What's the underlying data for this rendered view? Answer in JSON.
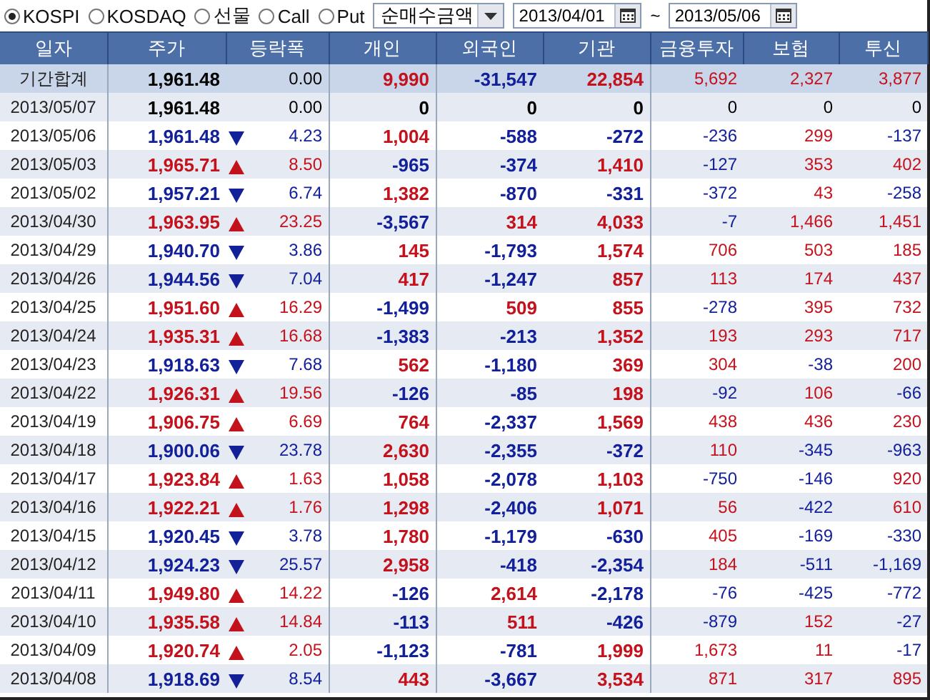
{
  "markets": [
    {
      "label": "KOSPI",
      "selected": true
    },
    {
      "label": "KOSDAQ",
      "selected": false
    },
    {
      "label": "선물",
      "selected": false
    },
    {
      "label": "Call",
      "selected": false
    },
    {
      "label": "Put",
      "selected": false
    }
  ],
  "measure": {
    "value": "순매수금액"
  },
  "date_range": {
    "start": "2013/04/01",
    "separator": "~",
    "end": "2013/05/06"
  },
  "columns": [
    "일자",
    "주가",
    "등락폭",
    "개인",
    "외국인",
    "기관",
    "금융투자",
    "보험",
    "투신"
  ],
  "rows": [
    {
      "kind": "total",
      "date": "기간합계",
      "price": "1,961.48",
      "rising": false,
      "falling": false,
      "change": "0.00",
      "flows": [
        {
          "value": "9,990",
          "color": "#c4121c"
        },
        {
          "value": "-31,547",
          "color": "#12209a"
        },
        {
          "value": "22,854",
          "color": "#c4121c"
        },
        {
          "value": "5,692",
          "color": "#c4121c"
        },
        {
          "value": "2,327",
          "color": "#c4121c"
        },
        {
          "value": "3,877",
          "color": "#c4121c"
        }
      ]
    },
    {
      "kind": "day",
      "date": "2013/05/07",
      "price": "1,961.48",
      "rising": false,
      "falling": false,
      "change": "0.00",
      "flows": [
        {
          "value": "0",
          "color": "#000000"
        },
        {
          "value": "0",
          "color": "#000000"
        },
        {
          "value": "0",
          "color": "#000000"
        },
        {
          "value": "0",
          "color": "#000000"
        },
        {
          "value": "0",
          "color": "#000000"
        },
        {
          "value": "0",
          "color": "#000000"
        }
      ]
    },
    {
      "kind": "day",
      "date": "2013/05/06",
      "price": "1,961.48",
      "rising": false,
      "falling": true,
      "change": "4.23",
      "flows": [
        {
          "value": "1,004",
          "color": "#c4121c"
        },
        {
          "value": "-588",
          "color": "#12209a"
        },
        {
          "value": "-272",
          "color": "#12209a"
        },
        {
          "value": "-236",
          "color": "#12209a"
        },
        {
          "value": "299",
          "color": "#c4121c"
        },
        {
          "value": "-137",
          "color": "#12209a"
        }
      ]
    },
    {
      "kind": "day",
      "date": "2013/05/03",
      "price": "1,965.71",
      "rising": true,
      "falling": false,
      "change": "8.50",
      "flows": [
        {
          "value": "-965",
          "color": "#12209a"
        },
        {
          "value": "-374",
          "color": "#12209a"
        },
        {
          "value": "1,410",
          "color": "#c4121c"
        },
        {
          "value": "-127",
          "color": "#12209a"
        },
        {
          "value": "353",
          "color": "#c4121c"
        },
        {
          "value": "402",
          "color": "#c4121c"
        }
      ]
    },
    {
      "kind": "day",
      "date": "2013/05/02",
      "price": "1,957.21",
      "rising": false,
      "falling": true,
      "change": "6.74",
      "flows": [
        {
          "value": "1,382",
          "color": "#c4121c"
        },
        {
          "value": "-870",
          "color": "#12209a"
        },
        {
          "value": "-331",
          "color": "#12209a"
        },
        {
          "value": "-372",
          "color": "#12209a"
        },
        {
          "value": "43",
          "color": "#c4121c"
        },
        {
          "value": "-258",
          "color": "#12209a"
        }
      ]
    },
    {
      "kind": "day",
      "date": "2013/04/30",
      "price": "1,963.95",
      "rising": true,
      "falling": false,
      "change": "23.25",
      "flows": [
        {
          "value": "-3,567",
          "color": "#12209a"
        },
        {
          "value": "314",
          "color": "#c4121c"
        },
        {
          "value": "4,033",
          "color": "#c4121c"
        },
        {
          "value": "-7",
          "color": "#12209a"
        },
        {
          "value": "1,466",
          "color": "#c4121c"
        },
        {
          "value": "1,451",
          "color": "#c4121c"
        }
      ]
    },
    {
      "kind": "day",
      "date": "2013/04/29",
      "price": "1,940.70",
      "rising": false,
      "falling": true,
      "change": "3.86",
      "flows": [
        {
          "value": "145",
          "color": "#c4121c"
        },
        {
          "value": "-1,793",
          "color": "#12209a"
        },
        {
          "value": "1,574",
          "color": "#c4121c"
        },
        {
          "value": "706",
          "color": "#c4121c"
        },
        {
          "value": "503",
          "color": "#c4121c"
        },
        {
          "value": "185",
          "color": "#c4121c"
        }
      ]
    },
    {
      "kind": "day",
      "date": "2013/04/26",
      "price": "1,944.56",
      "rising": false,
      "falling": true,
      "change": "7.04",
      "flows": [
        {
          "value": "417",
          "color": "#c4121c"
        },
        {
          "value": "-1,247",
          "color": "#12209a"
        },
        {
          "value": "857",
          "color": "#c4121c"
        },
        {
          "value": "113",
          "color": "#c4121c"
        },
        {
          "value": "174",
          "color": "#c4121c"
        },
        {
          "value": "437",
          "color": "#c4121c"
        }
      ]
    },
    {
      "kind": "day",
      "date": "2013/04/25",
      "price": "1,951.60",
      "rising": true,
      "falling": false,
      "change": "16.29",
      "flows": [
        {
          "value": "-1,499",
          "color": "#12209a"
        },
        {
          "value": "509",
          "color": "#c4121c"
        },
        {
          "value": "855",
          "color": "#c4121c"
        },
        {
          "value": "-278",
          "color": "#12209a"
        },
        {
          "value": "395",
          "color": "#c4121c"
        },
        {
          "value": "732",
          "color": "#c4121c"
        }
      ]
    },
    {
      "kind": "day",
      "date": "2013/04/24",
      "price": "1,935.31",
      "rising": true,
      "falling": false,
      "change": "16.68",
      "flows": [
        {
          "value": "-1,383",
          "color": "#12209a"
        },
        {
          "value": "-213",
          "color": "#12209a"
        },
        {
          "value": "1,352",
          "color": "#c4121c"
        },
        {
          "value": "193",
          "color": "#c4121c"
        },
        {
          "value": "293",
          "color": "#c4121c"
        },
        {
          "value": "717",
          "color": "#c4121c"
        }
      ]
    },
    {
      "kind": "day",
      "date": "2013/04/23",
      "price": "1,918.63",
      "rising": false,
      "falling": true,
      "change": "7.68",
      "flows": [
        {
          "value": "562",
          "color": "#c4121c"
        },
        {
          "value": "-1,180",
          "color": "#12209a"
        },
        {
          "value": "369",
          "color": "#c4121c"
        },
        {
          "value": "304",
          "color": "#c4121c"
        },
        {
          "value": "-38",
          "color": "#12209a"
        },
        {
          "value": "200",
          "color": "#c4121c"
        }
      ]
    },
    {
      "kind": "day",
      "date": "2013/04/22",
      "price": "1,926.31",
      "rising": true,
      "falling": false,
      "change": "19.56",
      "flows": [
        {
          "value": "-126",
          "color": "#12209a"
        },
        {
          "value": "-85",
          "color": "#12209a"
        },
        {
          "value": "198",
          "color": "#c4121c"
        },
        {
          "value": "-92",
          "color": "#12209a"
        },
        {
          "value": "106",
          "color": "#c4121c"
        },
        {
          "value": "-66",
          "color": "#12209a"
        }
      ]
    },
    {
      "kind": "day",
      "date": "2013/04/19",
      "price": "1,906.75",
      "rising": true,
      "falling": false,
      "change": "6.69",
      "flows": [
        {
          "value": "764",
          "color": "#c4121c"
        },
        {
          "value": "-2,337",
          "color": "#12209a"
        },
        {
          "value": "1,569",
          "color": "#c4121c"
        },
        {
          "value": "438",
          "color": "#c4121c"
        },
        {
          "value": "436",
          "color": "#c4121c"
        },
        {
          "value": "230",
          "color": "#c4121c"
        }
      ]
    },
    {
      "kind": "day",
      "date": "2013/04/18",
      "price": "1,900.06",
      "rising": false,
      "falling": true,
      "change": "23.78",
      "flows": [
        {
          "value": "2,630",
          "color": "#c4121c"
        },
        {
          "value": "-2,355",
          "color": "#12209a"
        },
        {
          "value": "-372",
          "color": "#12209a"
        },
        {
          "value": "110",
          "color": "#c4121c"
        },
        {
          "value": "-345",
          "color": "#12209a"
        },
        {
          "value": "-963",
          "color": "#12209a"
        }
      ]
    },
    {
      "kind": "day",
      "date": "2013/04/17",
      "price": "1,923.84",
      "rising": true,
      "falling": false,
      "change": "1.63",
      "flows": [
        {
          "value": "1,058",
          "color": "#c4121c"
        },
        {
          "value": "-2,078",
          "color": "#12209a"
        },
        {
          "value": "1,103",
          "color": "#c4121c"
        },
        {
          "value": "-750",
          "color": "#12209a"
        },
        {
          "value": "-146",
          "color": "#12209a"
        },
        {
          "value": "920",
          "color": "#c4121c"
        }
      ]
    },
    {
      "kind": "day",
      "date": "2013/04/16",
      "price": "1,922.21",
      "rising": true,
      "falling": false,
      "change": "1.76",
      "flows": [
        {
          "value": "1,298",
          "color": "#c4121c"
        },
        {
          "value": "-2,406",
          "color": "#12209a"
        },
        {
          "value": "1,071",
          "color": "#c4121c"
        },
        {
          "value": "56",
          "color": "#c4121c"
        },
        {
          "value": "-422",
          "color": "#12209a"
        },
        {
          "value": "610",
          "color": "#c4121c"
        }
      ]
    },
    {
      "kind": "day",
      "date": "2013/04/15",
      "price": "1,920.45",
      "rising": false,
      "falling": true,
      "change": "3.78",
      "flows": [
        {
          "value": "1,780",
          "color": "#c4121c"
        },
        {
          "value": "-1,179",
          "color": "#12209a"
        },
        {
          "value": "-630",
          "color": "#12209a"
        },
        {
          "value": "405",
          "color": "#c4121c"
        },
        {
          "value": "-169",
          "color": "#12209a"
        },
        {
          "value": "-330",
          "color": "#12209a"
        }
      ]
    },
    {
      "kind": "day",
      "date": "2013/04/12",
      "price": "1,924.23",
      "rising": false,
      "falling": true,
      "change": "25.57",
      "flows": [
        {
          "value": "2,958",
          "color": "#c4121c"
        },
        {
          "value": "-418",
          "color": "#12209a"
        },
        {
          "value": "-2,354",
          "color": "#12209a"
        },
        {
          "value": "184",
          "color": "#c4121c"
        },
        {
          "value": "-511",
          "color": "#12209a"
        },
        {
          "value": "-1,169",
          "color": "#12209a"
        }
      ]
    },
    {
      "kind": "day",
      "date": "2013/04/11",
      "price": "1,949.80",
      "rising": true,
      "falling": false,
      "change": "14.22",
      "flows": [
        {
          "value": "-126",
          "color": "#12209a"
        },
        {
          "value": "2,614",
          "color": "#c4121c"
        },
        {
          "value": "-2,178",
          "color": "#12209a"
        },
        {
          "value": "-76",
          "color": "#12209a"
        },
        {
          "value": "-425",
          "color": "#12209a"
        },
        {
          "value": "-772",
          "color": "#12209a"
        }
      ]
    },
    {
      "kind": "day",
      "date": "2013/04/10",
      "price": "1,935.58",
      "rising": true,
      "falling": false,
      "change": "14.84",
      "flows": [
        {
          "value": "-113",
          "color": "#12209a"
        },
        {
          "value": "511",
          "color": "#c4121c"
        },
        {
          "value": "-426",
          "color": "#12209a"
        },
        {
          "value": "-879",
          "color": "#12209a"
        },
        {
          "value": "152",
          "color": "#c4121c"
        },
        {
          "value": "-27",
          "color": "#12209a"
        }
      ]
    },
    {
      "kind": "day",
      "date": "2013/04/09",
      "price": "1,920.74",
      "rising": true,
      "falling": false,
      "change": "2.05",
      "flows": [
        {
          "value": "-1,123",
          "color": "#12209a"
        },
        {
          "value": "-781",
          "color": "#12209a"
        },
        {
          "value": "1,999",
          "color": "#c4121c"
        },
        {
          "value": "1,673",
          "color": "#c4121c"
        },
        {
          "value": "11",
          "color": "#c4121c"
        },
        {
          "value": "-17",
          "color": "#12209a"
        }
      ]
    },
    {
      "kind": "day",
      "date": "2013/04/08",
      "price": "1,918.69",
      "rising": false,
      "falling": true,
      "change": "8.54",
      "flows": [
        {
          "value": "443",
          "color": "#c4121c"
        },
        {
          "value": "-3,667",
          "color": "#12209a"
        },
        {
          "value": "3,534",
          "color": "#c4121c"
        },
        {
          "value": "871",
          "color": "#c4121c"
        },
        {
          "value": "317",
          "color": "#c4121c"
        },
        {
          "value": "895",
          "color": "#c4121c"
        }
      ]
    }
  ]
}
